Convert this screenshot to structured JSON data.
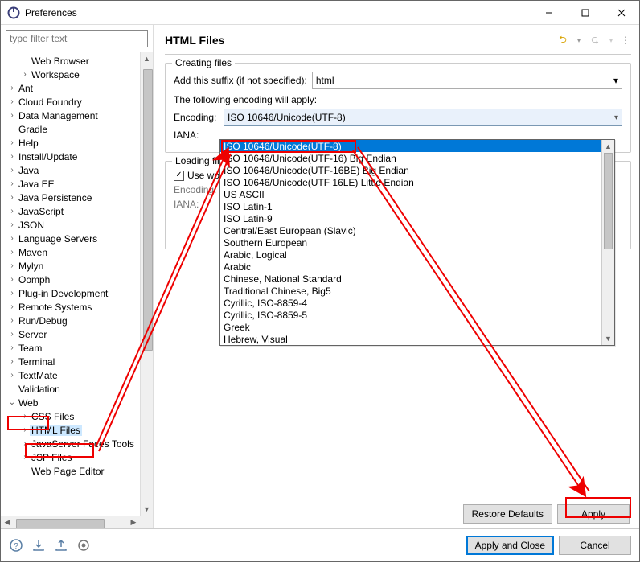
{
  "window": {
    "title": "Preferences"
  },
  "filter": {
    "placeholder": "type filter text"
  },
  "tree": [
    {
      "label": "Web Browser",
      "depth": 2,
      "tw": ""
    },
    {
      "label": "Workspace",
      "depth": 2,
      "tw": ">"
    },
    {
      "label": "Ant",
      "depth": 1,
      "tw": ">"
    },
    {
      "label": "Cloud Foundry",
      "depth": 1,
      "tw": ">"
    },
    {
      "label": "Data Management",
      "depth": 1,
      "tw": ">"
    },
    {
      "label": "Gradle",
      "depth": 1,
      "tw": ""
    },
    {
      "label": "Help",
      "depth": 1,
      "tw": ">"
    },
    {
      "label": "Install/Update",
      "depth": 1,
      "tw": ">"
    },
    {
      "label": "Java",
      "depth": 1,
      "tw": ">"
    },
    {
      "label": "Java EE",
      "depth": 1,
      "tw": ">"
    },
    {
      "label": "Java Persistence",
      "depth": 1,
      "tw": ">"
    },
    {
      "label": "JavaScript",
      "depth": 1,
      "tw": ">"
    },
    {
      "label": "JSON",
      "depth": 1,
      "tw": ">"
    },
    {
      "label": "Language Servers",
      "depth": 1,
      "tw": ">"
    },
    {
      "label": "Maven",
      "depth": 1,
      "tw": ">"
    },
    {
      "label": "Mylyn",
      "depth": 1,
      "tw": ">"
    },
    {
      "label": "Oomph",
      "depth": 1,
      "tw": ">"
    },
    {
      "label": "Plug-in Development",
      "depth": 1,
      "tw": ">"
    },
    {
      "label": "Remote Systems",
      "depth": 1,
      "tw": ">"
    },
    {
      "label": "Run/Debug",
      "depth": 1,
      "tw": ">"
    },
    {
      "label": "Server",
      "depth": 1,
      "tw": ">"
    },
    {
      "label": "Team",
      "depth": 1,
      "tw": ">"
    },
    {
      "label": "Terminal",
      "depth": 1,
      "tw": ">"
    },
    {
      "label": "TextMate",
      "depth": 1,
      "tw": ">"
    },
    {
      "label": "Validation",
      "depth": 1,
      "tw": ""
    },
    {
      "label": "Web",
      "depth": 1,
      "tw": "v"
    },
    {
      "label": "CSS Files",
      "depth": 2,
      "tw": ">"
    },
    {
      "label": "HTML Files",
      "depth": 2,
      "tw": ">",
      "selected": true
    },
    {
      "label": "JavaServer Faces Tools",
      "depth": 2,
      "tw": ">"
    },
    {
      "label": "JSP Files",
      "depth": 2,
      "tw": ">"
    },
    {
      "label": "Web Page Editor",
      "depth": 2,
      "tw": ""
    }
  ],
  "page": {
    "title": "HTML Files",
    "creating_group": "Creating files",
    "suffix_label": "Add this suffix (if not specified):",
    "suffix_value": "html",
    "encoding_note": "The following encoding will apply:",
    "encoding_label": "Encoding:",
    "encoding_value": "ISO 10646/Unicode(UTF-8)",
    "iana_label": "IANA:",
    "loading_group": "Loading files",
    "use_workspace": "Use workspace encoding",
    "encoding2_label": "Encoding:",
    "iana2_label": "IANA:"
  },
  "dropdown": [
    "ISO 10646/Unicode(UTF-8)",
    "ISO 10646/Unicode(UTF-16) Big Endian",
    "ISO 10646/Unicode(UTF-16BE) Big Endian",
    "ISO 10646/Unicode(UTF 16LE) Little Endian",
    "US ASCII",
    "ISO Latin-1",
    "ISO Latin-9",
    "Central/East European (Slavic)",
    "Southern European",
    "Arabic, Logical",
    "Arabic",
    "Chinese, National Standard",
    "Traditional Chinese, Big5",
    "Cyrillic, ISO-8859-4",
    "Cyrillic, ISO-8859-5",
    "Greek",
    "Hebrew, Visual"
  ],
  "buttons": {
    "restore": "Restore Defaults",
    "apply": "Apply",
    "apply_close": "Apply and Close",
    "cancel": "Cancel"
  },
  "annotations": {
    "highlights": [
      "Web (tree)",
      "HTML Files (tree)",
      "ISO 10646/Unicode(UTF-8) (dropdown)",
      "Apply (button)"
    ],
    "arrows": [
      {
        "from": "HTML Files tree item",
        "to": "Encoding dropdown top"
      },
      {
        "from": "Encoding dropdown top",
        "to": "Apply button"
      }
    ]
  }
}
